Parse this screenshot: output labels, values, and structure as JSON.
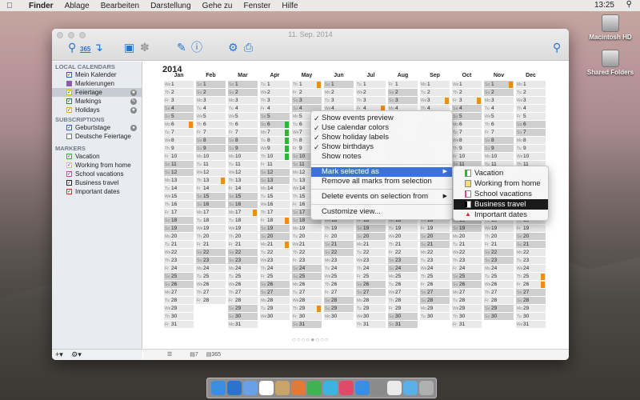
{
  "menubar": {
    "app": "Finder",
    "items": [
      "Ablage",
      "Bearbeiten",
      "Darstellung",
      "Gehe zu",
      "Fenster",
      "Hilfe"
    ],
    "clock": "13:25"
  },
  "desktop": {
    "icons": [
      {
        "label": "Macintosh HD"
      },
      {
        "label": "Shared Folders"
      }
    ]
  },
  "window": {
    "title": "11. Sep. 2014",
    "toolbar": {
      "year_view_label": "365",
      "week_label": "7"
    }
  },
  "sidebar": {
    "sections": [
      {
        "title": "LOCAL CALENDARS",
        "items": [
          {
            "label": "Mein Kalender",
            "color": "#1f5fd0",
            "checked": true
          },
          {
            "label": "Markierungen",
            "color": "#8a5fa8",
            "checked": false
          },
          {
            "label": "Feiertage",
            "color": "#e8b000",
            "checked": true,
            "selected": true
          },
          {
            "label": "Markings",
            "color": "#2a66c8",
            "checked": true
          },
          {
            "label": "Holidays",
            "color": "#e8b000",
            "checked": true
          }
        ]
      },
      {
        "title": "SUBSCRIPTIONS",
        "items": [
          {
            "label": "Geburtstage",
            "color": "#2a66c8",
            "checked": true
          },
          {
            "label": "Deutsche Feiertage",
            "color": "#2a66c8",
            "checked": false
          }
        ]
      },
      {
        "title": "MARKERS",
        "items": [
          {
            "label": "Vacation",
            "color": "#2eb62e"
          },
          {
            "label": "Working from home",
            "color": "#e8c84a"
          },
          {
            "label": "School vacations",
            "color": "#e04090"
          },
          {
            "label": "Business travel",
            "color": "#222222"
          },
          {
            "label": "Important dates",
            "color": "#d0312d"
          }
        ]
      }
    ]
  },
  "calendar": {
    "year": "2014",
    "months": [
      "Jan",
      "Feb",
      "Mar",
      "Apr",
      "May",
      "Jun",
      "Jul",
      "Aug",
      "Sep",
      "Oct",
      "Nov",
      "Dec"
    ]
  },
  "context_menu": {
    "items": [
      {
        "label": "Show events preview",
        "checked": true
      },
      {
        "label": "Use calendar colors",
        "checked": true
      },
      {
        "label": "Show holiday labels",
        "checked": true
      },
      {
        "label": "Show birthdays",
        "checked": true
      },
      {
        "label": "Show notes",
        "checked": false
      }
    ],
    "mark_selected": "Mark selected as",
    "remove_marks": "Remove all marks from selection",
    "delete_events": "Delete events on selection from",
    "customize": "Customize view..."
  },
  "submenu": {
    "items": [
      {
        "label": "Vacation",
        "color": "#2eb62e"
      },
      {
        "label": "Working from home",
        "color": "#e8c84a"
      },
      {
        "label": "School vacations",
        "color": "#e04090"
      },
      {
        "label": "Business travel",
        "color": "#222222",
        "highlighted": true
      },
      {
        "label": "Important dates",
        "color": "#d0312d"
      }
    ]
  },
  "colors": {
    "accent": "#2a74c9",
    "orange_marker": "#f08a1c",
    "green_marker": "#2eb62e"
  }
}
